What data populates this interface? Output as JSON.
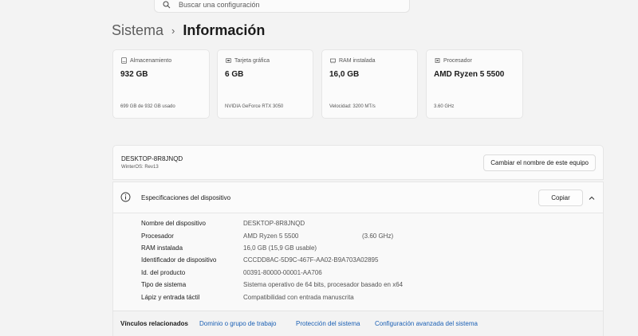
{
  "search": {
    "placeholder": "Buscar una configuración"
  },
  "breadcrumb": {
    "parent": "Sistema",
    "separator": "›",
    "current": "Información"
  },
  "cards": [
    {
      "label": "Almacenamiento",
      "value": "932 GB",
      "sub": "699 GB de 932 GB usado",
      "icon": "storage-icon"
    },
    {
      "label": "Tarjeta gráfica",
      "value": "6 GB",
      "sub": "NVIDIA GeForce RTX 3050",
      "icon": "graphics-card-icon"
    },
    {
      "label": "RAM instalada",
      "value": "16,0 GB",
      "sub": "Velocidad: 3200 MT/s",
      "icon": "ram-icon"
    },
    {
      "label": "Procesador",
      "value": "AMD Ryzen 5 5500",
      "sub": "3.60 GHz",
      "icon": "processor-icon"
    }
  ],
  "device": {
    "name": "DESKTOP-8R8JNQD",
    "os": "WinterOS: Rev13",
    "rename_label": "Cambiar el nombre de este equipo"
  },
  "specs": {
    "title": "Especificaciones del dispositivo",
    "copy_label": "Copiar",
    "rows": [
      {
        "label": "Nombre del dispositivo",
        "value": "DESKTOP-8R8JNQD",
        "extra": ""
      },
      {
        "label": "Procesador",
        "value": "AMD Ryzen 5 5500",
        "extra": "(3.60 GHz)"
      },
      {
        "label": "RAM instalada",
        "value": "16,0 GB (15,9 GB usable)",
        "extra": ""
      },
      {
        "label": "Identificador de dispositivo",
        "value": "CCCDD8AC-5D9C-467F-AA02-B9A703A02895",
        "extra": ""
      },
      {
        "label": "Id. del producto",
        "value": "00391-80000-00001-AA706",
        "extra": ""
      },
      {
        "label": "Tipo de sistema",
        "value": "Sistema operativo de 64 bits, procesador basado en x64",
        "extra": ""
      },
      {
        "label": "Lápiz y entrada táctil",
        "value": "Compatibilidad con entrada manuscrita",
        "extra": ""
      }
    ]
  },
  "related": {
    "title": "Vínculos relacionados",
    "links": [
      "Dominio o grupo de trabajo",
      "Protección del sistema",
      "Configuración avanzada del sistema"
    ]
  },
  "colors": {
    "accent": "#1a5fb4",
    "background": "#f3f3f3",
    "card": "#fbfbfb"
  }
}
